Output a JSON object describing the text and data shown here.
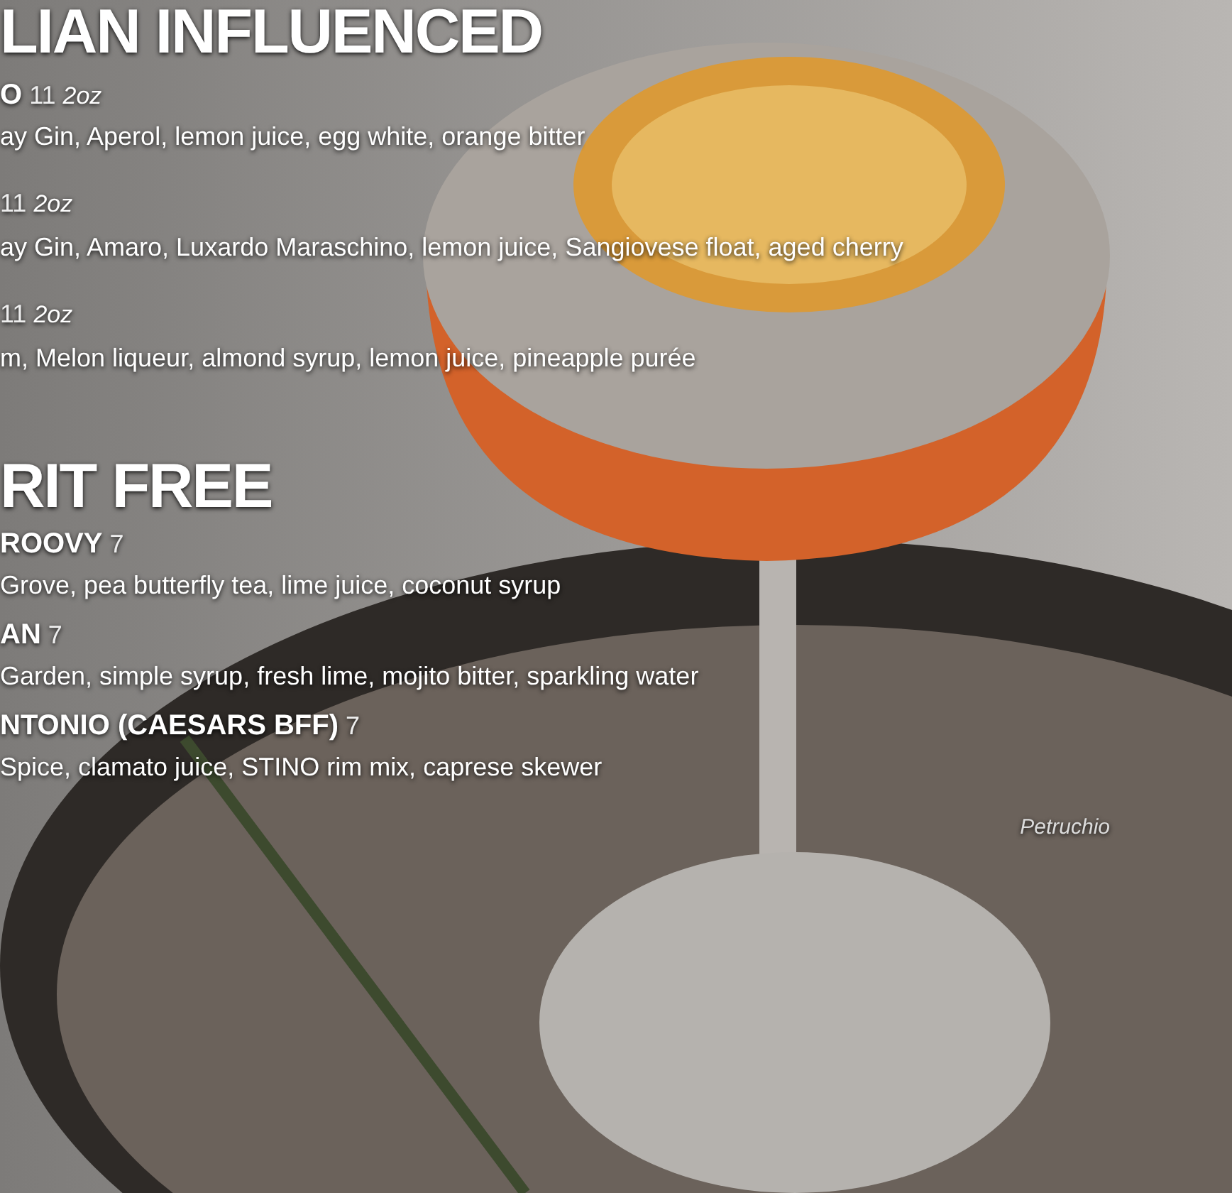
{
  "sections": [
    {
      "title": "LIAN INFLUENCED",
      "items": [
        {
          "name": "O",
          "price": "11",
          "size": "2oz",
          "description": "ay Gin, Aperol, lemon juice, egg white, orange bitter"
        },
        {
          "price": "11",
          "size": "2oz",
          "description": "ay Gin, Amaro, Luxardo Maraschino, lemon juice, Sangiovese float, aged cherry"
        },
        {
          "price": "11",
          "size": "2oz",
          "description": "m, Melon liqueur, almond syrup, lemon juice, pineapple purée"
        }
      ]
    },
    {
      "title": "RIT FREE",
      "items": [
        {
          "name": "ROOVY",
          "price": "7",
          "description": "Grove, pea butterfly tea, lime juice, coconut syrup"
        },
        {
          "name": "AN",
          "price": "7",
          "description": "Garden, simple syrup, fresh lime, mojito bitter, sparkling water"
        },
        {
          "name": "NTONIO (CAESARS BFF)",
          "price": "7",
          "description": "Spice, clamato juice, STINO rim mix, caprese skewer"
        }
      ]
    }
  ],
  "photo_caption": "Petruchio"
}
